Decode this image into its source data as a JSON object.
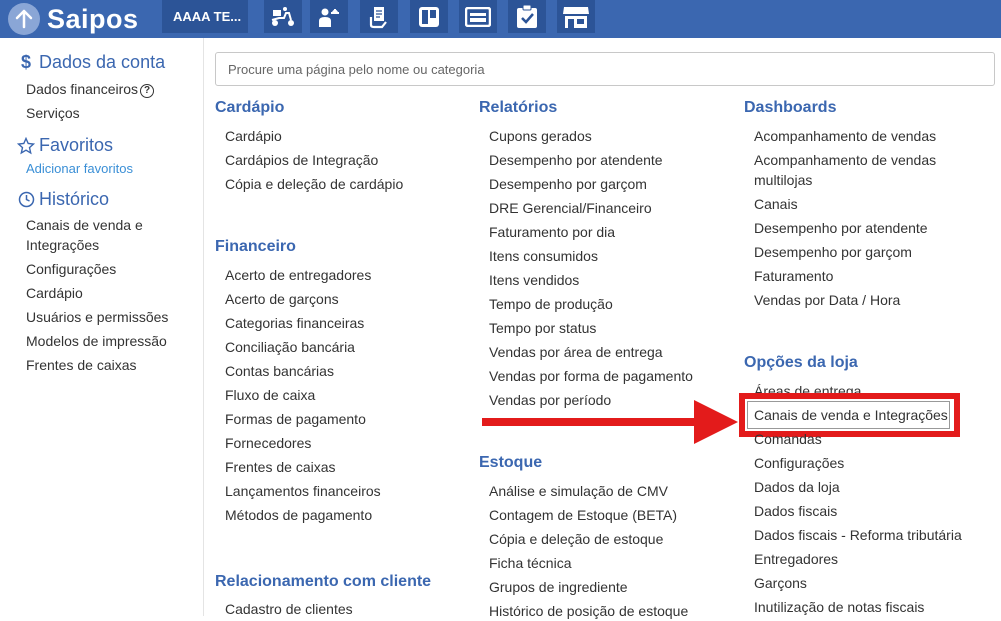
{
  "header": {
    "logo": "Saipos",
    "store": "AAAA TE...",
    "icons": [
      "delivery-scooter-icon",
      "waiter-icon",
      "receipt-hand-icon",
      "kanban-board-icon",
      "display-icon",
      "checklist-icon",
      "storefront-icon"
    ]
  },
  "sidebar": {
    "account": {
      "title": "Dados da conta",
      "items": [
        "Dados financeiros",
        "Serviços"
      ],
      "help": "?"
    },
    "favorites": {
      "title": "Favoritos",
      "add": "Adicionar favoritos"
    },
    "history": {
      "title": "Histórico",
      "items": [
        "Canais de venda e Integrações",
        "Configurações",
        "Cardápio",
        "Usuários e permissões",
        "Modelos de impressão",
        "Frentes de caixas"
      ]
    }
  },
  "search": {
    "placeholder": "Procure uma página pelo nome ou categoria"
  },
  "columns": {
    "cardapio": {
      "title": "Cardápio",
      "items": [
        "Cardápio",
        "Cardápios de Integração",
        "Cópia e deleção de cardápio"
      ]
    },
    "financeiro": {
      "title": "Financeiro",
      "items": [
        "Acerto de entregadores",
        "Acerto de garçons",
        "Categorias financeiras",
        "Conciliação bancária",
        "Contas bancárias",
        "Fluxo de caixa",
        "Formas de pagamento",
        "Fornecedores",
        "Frentes de caixas",
        "Lançamentos financeiros",
        "Métodos de pagamento"
      ]
    },
    "relacionamento": {
      "title": "Relacionamento com cliente",
      "items": [
        "Cadastro de clientes"
      ]
    },
    "relatorios": {
      "title": "Relatórios",
      "items": [
        "Cupons gerados",
        "Desempenho por atendente",
        "Desempenho por garçom",
        "DRE Gerencial/Financeiro",
        "Faturamento por dia",
        "Itens consumidos",
        "Itens vendidos",
        "Tempo de produção",
        "Tempo por status",
        "Vendas por área de entrega",
        "Vendas por forma de pagamento",
        "Vendas por período"
      ]
    },
    "estoque": {
      "title": "Estoque",
      "items": [
        "Análise e simulação de CMV",
        "Contagem de Estoque (BETA)",
        "Cópia e deleção de estoque",
        "Ficha técnica",
        "Grupos de ingrediente",
        "Histórico de posição de estoque"
      ]
    },
    "dashboards": {
      "title": "Dashboards",
      "items": [
        "Acompanhamento de vendas",
        "Acompanhamento de vendas multilojas",
        "Canais",
        "Desempenho por atendente",
        "Desempenho por garçom",
        "Faturamento",
        "Vendas por Data / Hora"
      ]
    },
    "opcoes": {
      "title": "Opções da loja",
      "items": [
        "Áreas de entrega",
        "Canais de venda e Integrações",
        "Comandas",
        "Configurações",
        "Dados da loja",
        "Dados fiscais",
        "Dados fiscais - Reforma tributária",
        "Entregadores",
        "Garçons",
        "Inutilização de notas fiscais"
      ]
    }
  },
  "colors": {
    "brand": "#3b67b0",
    "header_dark": "#2c5497",
    "highlight": "#e31b1b",
    "link": "#3a8fd6"
  }
}
